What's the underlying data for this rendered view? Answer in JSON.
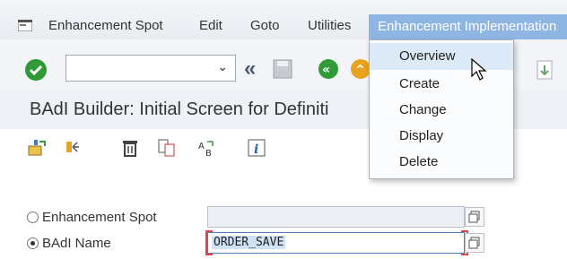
{
  "menubar": {
    "items": [
      {
        "label": "Enhancement Spot"
      },
      {
        "label": "Edit"
      },
      {
        "label": "Goto"
      },
      {
        "label": "Utilities"
      },
      {
        "label": "Enhancement Implementation"
      }
    ]
  },
  "toolbar": {
    "command_value": "",
    "icons": [
      "ok-check-icon",
      "back-double-arrow-icon",
      "save-icon",
      "back-icon",
      "exit-icon",
      "copy-icon"
    ]
  },
  "title": "BAdI Builder: Initial Screen for Definiti",
  "app_toolbar": {
    "icons": [
      "other-object-icon",
      "hierarchy-icon",
      "delete-icon",
      "copy-as-icon",
      "rename-icon",
      "info-icon"
    ]
  },
  "form": {
    "rows": [
      {
        "label": "Enhancement Spot",
        "value": "",
        "selected": false
      },
      {
        "label": "BAdI Name",
        "value": "ORDER_SAVE",
        "selected": true
      }
    ]
  },
  "dropdown": {
    "items": [
      {
        "label": "Overview",
        "hover": true
      },
      {
        "label": "Create",
        "hover": false
      },
      {
        "label": "Change",
        "hover": false
      },
      {
        "label": "Display",
        "hover": false
      },
      {
        "label": "Delete",
        "hover": false
      }
    ]
  },
  "colors": {
    "menu_active": "#8fb6e2",
    "ok_green": "#2f9a36",
    "accent_red": "#d44444"
  }
}
